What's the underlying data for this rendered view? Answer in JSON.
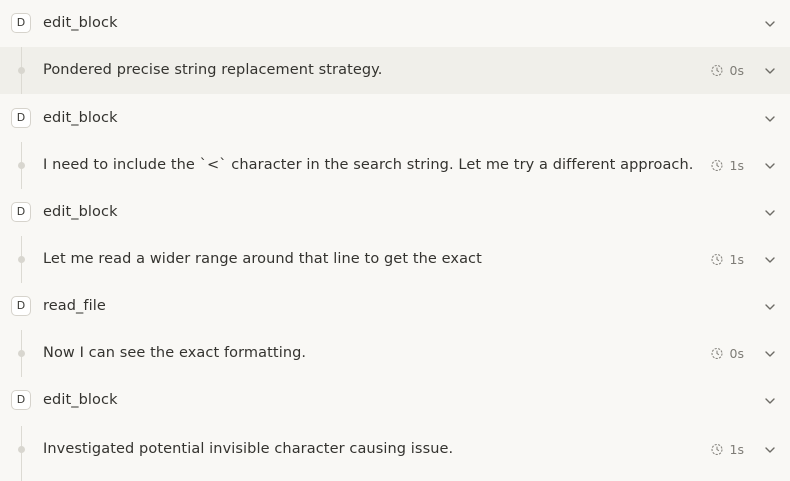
{
  "timeline": {
    "rows": [
      {
        "kind": "tool",
        "badge": "D",
        "label": "edit_block"
      },
      {
        "kind": "thought",
        "label": "Pondered precise string replacement strategy.",
        "duration": "0s",
        "highlighted": true
      },
      {
        "kind": "tool",
        "badge": "D",
        "label": "edit_block"
      },
      {
        "kind": "thought",
        "label": "I need to include the `<` character in the search string. Let me try a different approach.",
        "duration": "1s"
      },
      {
        "kind": "tool",
        "badge": "D",
        "label": "edit_block"
      },
      {
        "kind": "thought",
        "label": "Let me read a wider range around that line to get the exact",
        "duration": "1s"
      },
      {
        "kind": "tool",
        "badge": "D",
        "label": "read_file"
      },
      {
        "kind": "thought",
        "label": "Now I can see the exact formatting.",
        "duration": "0s"
      },
      {
        "kind": "tool",
        "badge": "D",
        "label": "edit_block"
      },
      {
        "kind": "thought",
        "label": "Investigated potential invisible character causing issue.",
        "duration": "1s"
      }
    ],
    "icons": {
      "timer": "timer-icon",
      "expand": "chevron-down-icon"
    }
  }
}
